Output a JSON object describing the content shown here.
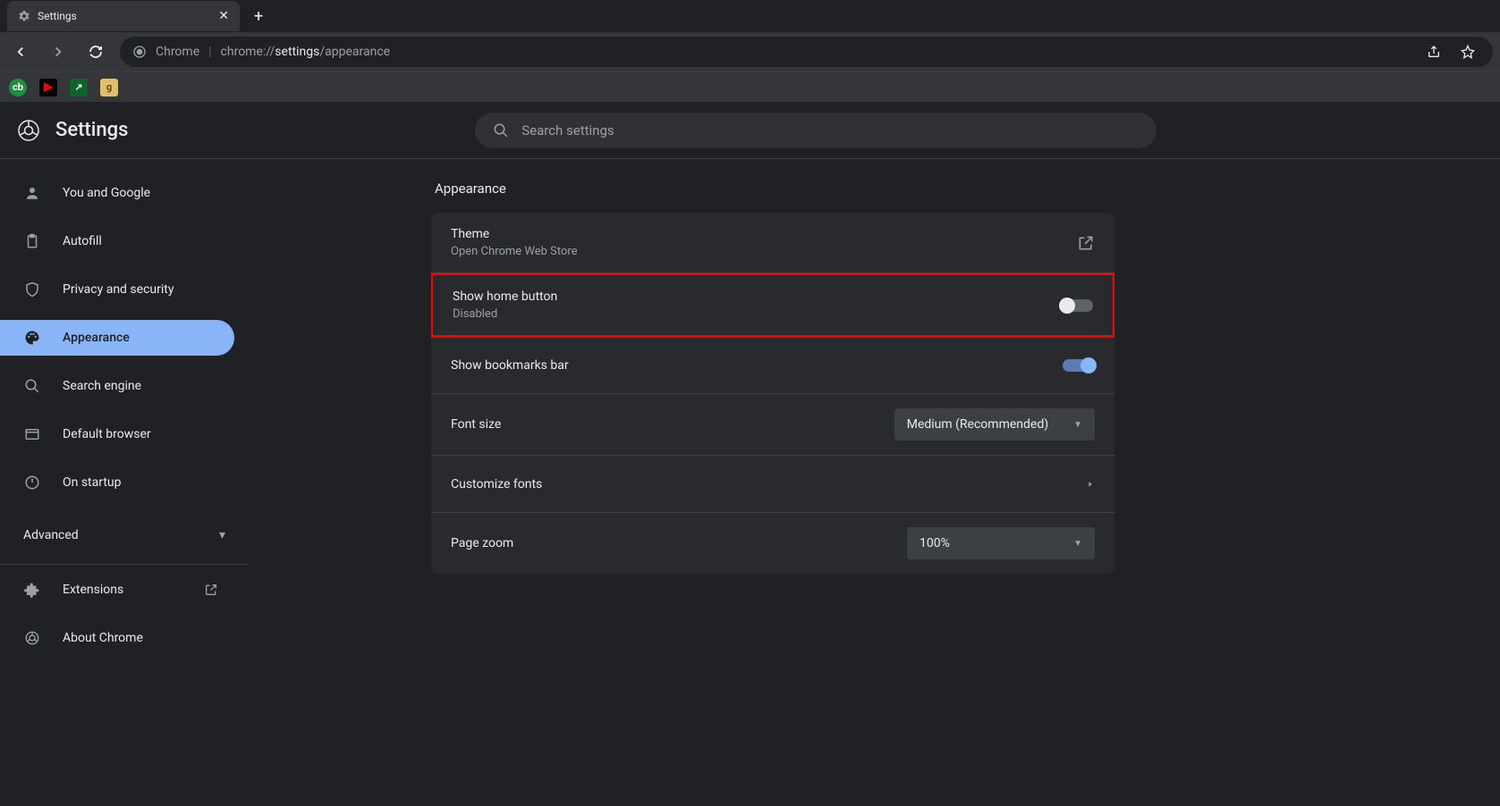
{
  "browser": {
    "tab_title": "Settings",
    "omnibox": {
      "site_label": "Chrome",
      "url_bold": "settings",
      "url_prefix": "chrome://",
      "url_suffix": "/appearance"
    }
  },
  "header": {
    "title": "Settings",
    "search_placeholder": "Search settings"
  },
  "sidebar": {
    "items": [
      {
        "label": "You and Google"
      },
      {
        "label": "Autofill"
      },
      {
        "label": "Privacy and security"
      },
      {
        "label": "Appearance"
      },
      {
        "label": "Search engine"
      },
      {
        "label": "Default browser"
      },
      {
        "label": "On startup"
      }
    ],
    "advanced_label": "Advanced",
    "extensions_label": "Extensions",
    "about_label": "About Chrome"
  },
  "main": {
    "section_title": "Appearance",
    "theme": {
      "title": "Theme",
      "sub": "Open Chrome Web Store"
    },
    "home_button": {
      "title": "Show home button",
      "sub": "Disabled"
    },
    "bookmarks_bar": {
      "title": "Show bookmarks bar"
    },
    "font_size": {
      "title": "Font size",
      "value": "Medium (Recommended)"
    },
    "customize_fonts": {
      "title": "Customize fonts"
    },
    "page_zoom": {
      "title": "Page zoom",
      "value": "100%"
    }
  }
}
